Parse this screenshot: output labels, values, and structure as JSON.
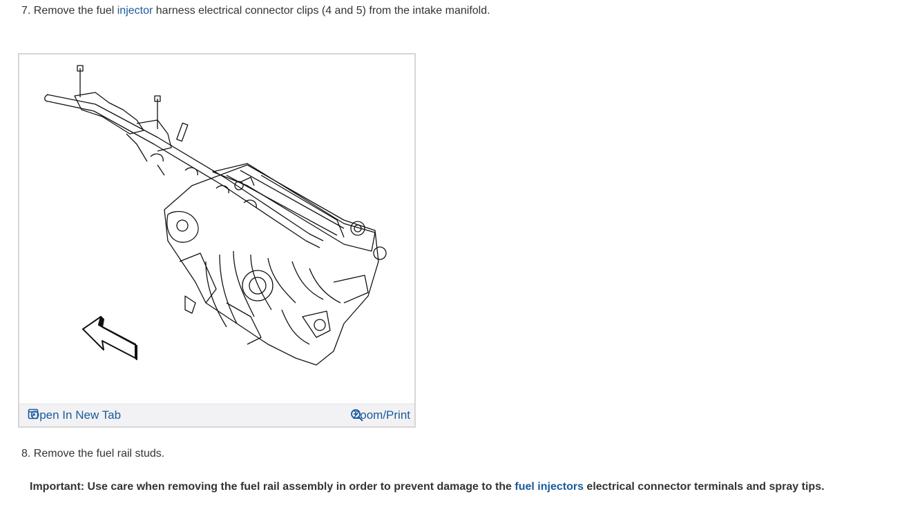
{
  "step7": {
    "prefix": "7. Remove the fuel ",
    "link": "injector",
    "suffix": " harness electrical connector clips (4 and 5) from the intake manifold."
  },
  "figure": {
    "open_label": "Open In New Tab",
    "zoom_label": "Zoom/Print",
    "link_color": "#1a5a9c"
  },
  "step8": {
    "text": "8. Remove the fuel rail studs."
  },
  "important": {
    "prefix": "Important: Use care when removing the fuel rail assembly in order to prevent damage to the ",
    "link": "fuel injectors",
    "suffix": " electrical connector terminals and spray tips."
  }
}
